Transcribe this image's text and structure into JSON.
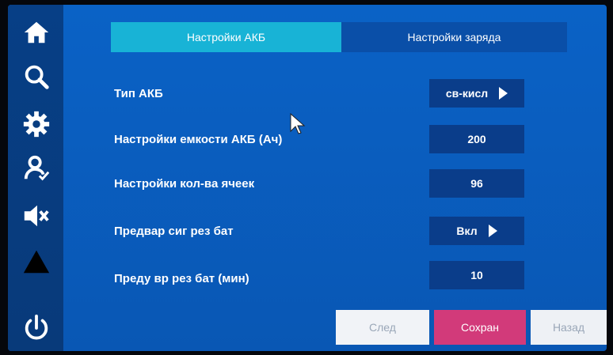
{
  "tabs": {
    "battery_settings": "Настройки АКБ",
    "charge_settings": "Настройки заряда"
  },
  "rows": [
    {
      "label": "Тип АКБ",
      "value": "св-кисл",
      "has_arrow": true
    },
    {
      "label": "Настройки емкости АКБ (Ач)",
      "value": "200",
      "has_arrow": false
    },
    {
      "label": "Настройки кол-ва ячеек",
      "value": "96",
      "has_arrow": false
    },
    {
      "label": "Предвар сиг рез бат",
      "value": "Вкл",
      "has_arrow": true
    },
    {
      "label": "Преду вр рез бат (мин)",
      "value": "10",
      "has_arrow": false
    }
  ],
  "buttons": {
    "next": "След",
    "save": "Сохран",
    "back": "Назад"
  },
  "sidebar": {
    "icons": [
      "home-icon",
      "search-icon",
      "gear-icon",
      "user-check-icon",
      "mute-icon",
      "warning-icon",
      "power-icon"
    ]
  },
  "colors": {
    "background": "#0a62c6",
    "tab_active": "#18b3d6",
    "value_box": "#0a3d8a",
    "save_button": "#d23a7a"
  }
}
